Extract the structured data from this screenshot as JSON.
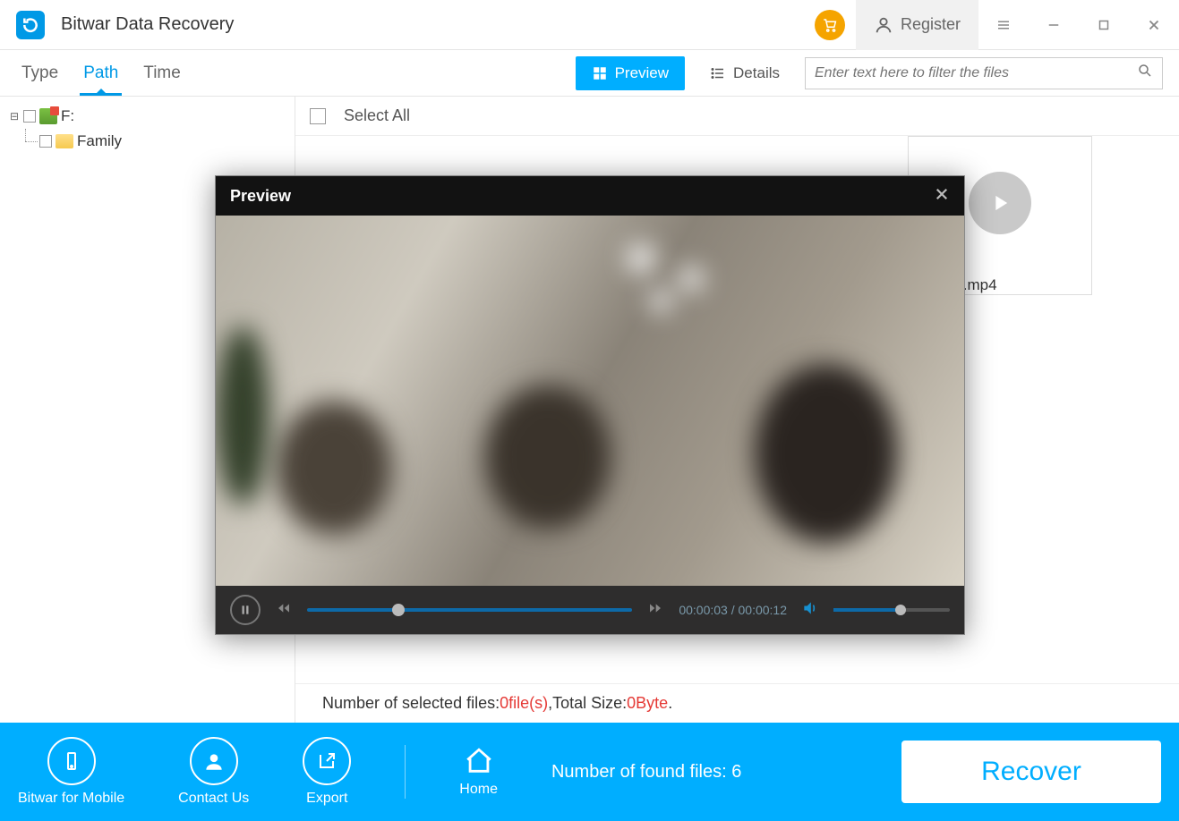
{
  "app": {
    "title": "Bitwar Data Recovery",
    "register_label": "Register"
  },
  "tabs": {
    "type": "Type",
    "path": "Path",
    "time": "Time",
    "active": "path"
  },
  "views": {
    "preview": "Preview",
    "details": "Details"
  },
  "filter": {
    "placeholder": "Enter text here to filter the files"
  },
  "tree": {
    "drive": "F:",
    "folder": "Family"
  },
  "main": {
    "select_all": "Select All",
    "visible_thumb_label": "741584.mp4",
    "status_prefix": "Number of selected files: ",
    "status_files": "0file(s) ",
    "status_size_label": ",Total Size: ",
    "status_size": "0Byte",
    "status_suffix": "."
  },
  "preview_modal": {
    "title": "Preview",
    "time_current": "00:00:03",
    "time_sep": " / ",
    "time_total": "00:00:12"
  },
  "footer": {
    "mobile": "Bitwar for Mobile",
    "contact": "Contact Us",
    "export": "Export",
    "home": "Home",
    "found_label": "Number of found files: ",
    "found_count": "6",
    "recover": "Recover"
  }
}
